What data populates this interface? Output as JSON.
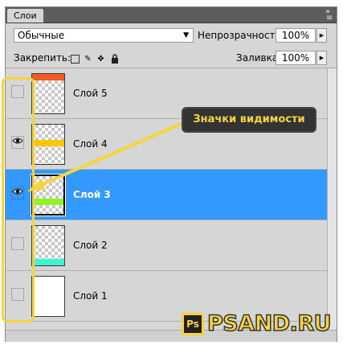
{
  "panel": {
    "tab_label": "Слои",
    "collapse_icon": "double-chevron-icon",
    "menu_icon": "panel-menu-icon"
  },
  "blend": {
    "mode": "Обычные",
    "opacity_label": "Непрозрачность:",
    "opacity_value": "100%"
  },
  "lock": {
    "label": "Закрепить:",
    "icons": [
      "lock-transparency-icon",
      "lock-image-icon",
      "lock-position-icon",
      "lock-all-icon"
    ],
    "fill_label": "Заливка:",
    "fill_value": "100%"
  },
  "layers": [
    {
      "name": "Слой 5",
      "visible": false,
      "selected": false,
      "stripe_color": "#f15a24",
      "stripe_pos": "top"
    },
    {
      "name": "Слой 4",
      "visible": true,
      "selected": false,
      "stripe_color": "#f9c800",
      "stripe_pos": "upper"
    },
    {
      "name": "Слой 3",
      "visible": true,
      "selected": true,
      "stripe_color": "#8ef224",
      "stripe_pos": "middle"
    },
    {
      "name": "Слой 2",
      "visible": false,
      "selected": false,
      "stripe_color": "#3ff2d0",
      "stripe_pos": "bottom"
    },
    {
      "name": "Слой 1",
      "visible": false,
      "selected": false,
      "stripe_color": "",
      "stripe_pos": "none"
    }
  ],
  "annotation": {
    "callout_text": "Значки видимости",
    "highlight_color": "#f7d43c"
  },
  "watermark": {
    "text": "PSAND.RU",
    "badge": "Ps"
  },
  "colors": {
    "selection": "#3399ff",
    "panel_bg": "#d6d6d6"
  }
}
